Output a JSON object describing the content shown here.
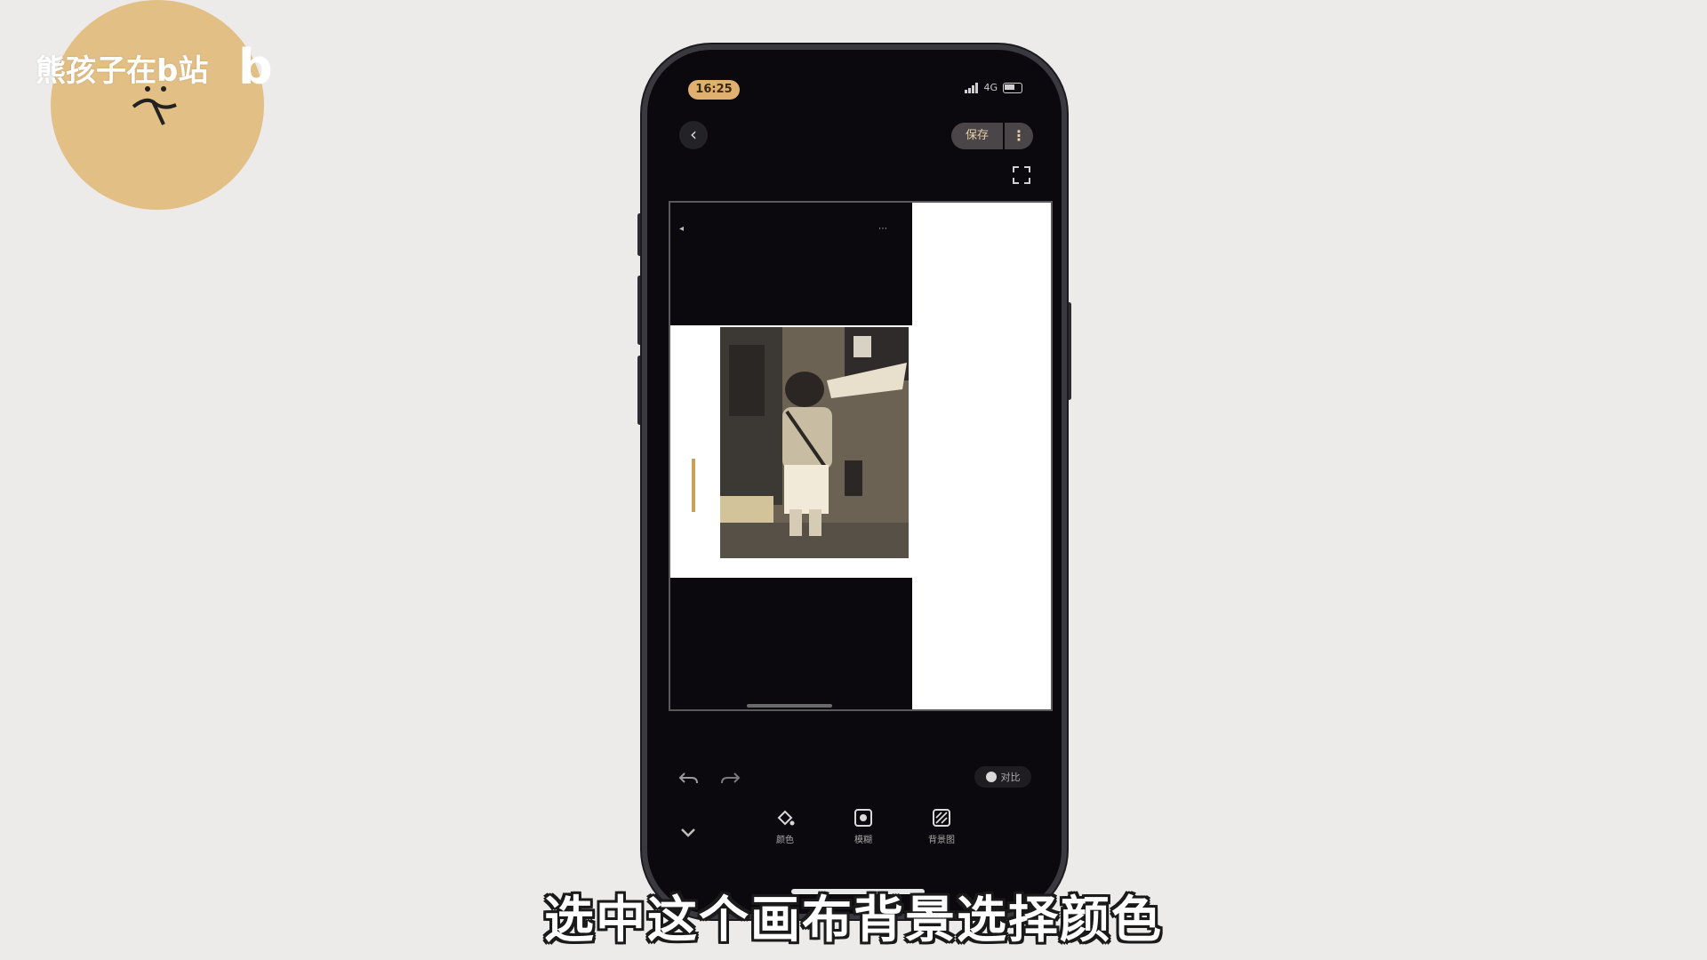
{
  "watermark": {
    "text": "熊孩子在b站",
    "logo": "b",
    "circle_color": "#e2bf85"
  },
  "status_bar": {
    "time": "16:25",
    "network": "4G",
    "icons": [
      "signal-icon",
      "battery-icon"
    ]
  },
  "top_bar": {
    "back_icon": "chevron-left-icon",
    "save_label": "保存",
    "more_label": "⋮",
    "fullscreen_icon": "expand-icon"
  },
  "canvas": {
    "background": "#0b090d",
    "canvas_fill": "#ffffff"
  },
  "edit_bar": {
    "undo_icon": "undo-icon",
    "redo_icon": "redo-icon",
    "compare_label": "对比"
  },
  "tools": [
    {
      "label": "颜色",
      "icon": "paint-bucket-icon"
    },
    {
      "label": "模糊",
      "icon": "blur-icon"
    },
    {
      "label": "背景图",
      "icon": "pattern-icon"
    }
  ],
  "subtitle": "选中这个画布背景选择颜色"
}
